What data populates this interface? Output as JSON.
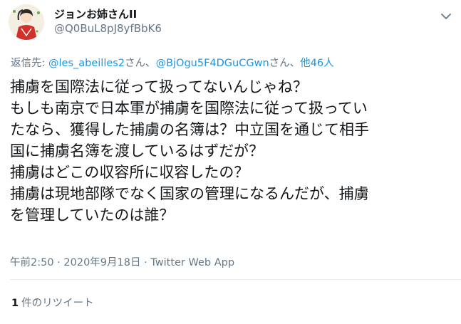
{
  "user": {
    "display_name": "ジョンお姉さんII",
    "handle": "@Q0BuL8pJ8yfBbK6"
  },
  "reply": {
    "prefix": "返信先: ",
    "mention1": "@les_abeilles2",
    "sep1": "さん、",
    "mention2": "@BjOgu5F4DGuCGwn",
    "sep2": "さん、",
    "others": "他46人"
  },
  "tweet": {
    "lines": [
      "捕虜を国際法に従って扱ってないんじゃね？",
      "もしも南京で日本軍が捕虜を国際法に従って扱ってい",
      "たなら、獲得した捕虜の名簿は？中立国を通じて相手",
      "国に捕虜名簿を渡しているはずだが？",
      "捕虜はどこの収容所に収容したの？",
      "捕虜は現地部隊でなく国家の管理になるんだが、捕虜",
      "を管理していたのは誰？"
    ]
  },
  "meta": {
    "time": "午前2:50",
    "dot1": " · ",
    "date": "2020年9月18日",
    "dot2": " · ",
    "source": "Twitter Web App"
  },
  "stats": {
    "retweet_count": "1",
    "retweet_label": "件のリツイート"
  },
  "icons": {
    "menu": "chevron-down-icon",
    "avatar": "user-avatar"
  },
  "colors": {
    "link": "#1b95e0",
    "secondary_text": "#657786",
    "primary_text": "#14171a",
    "divider": "#e6ecf0"
  }
}
